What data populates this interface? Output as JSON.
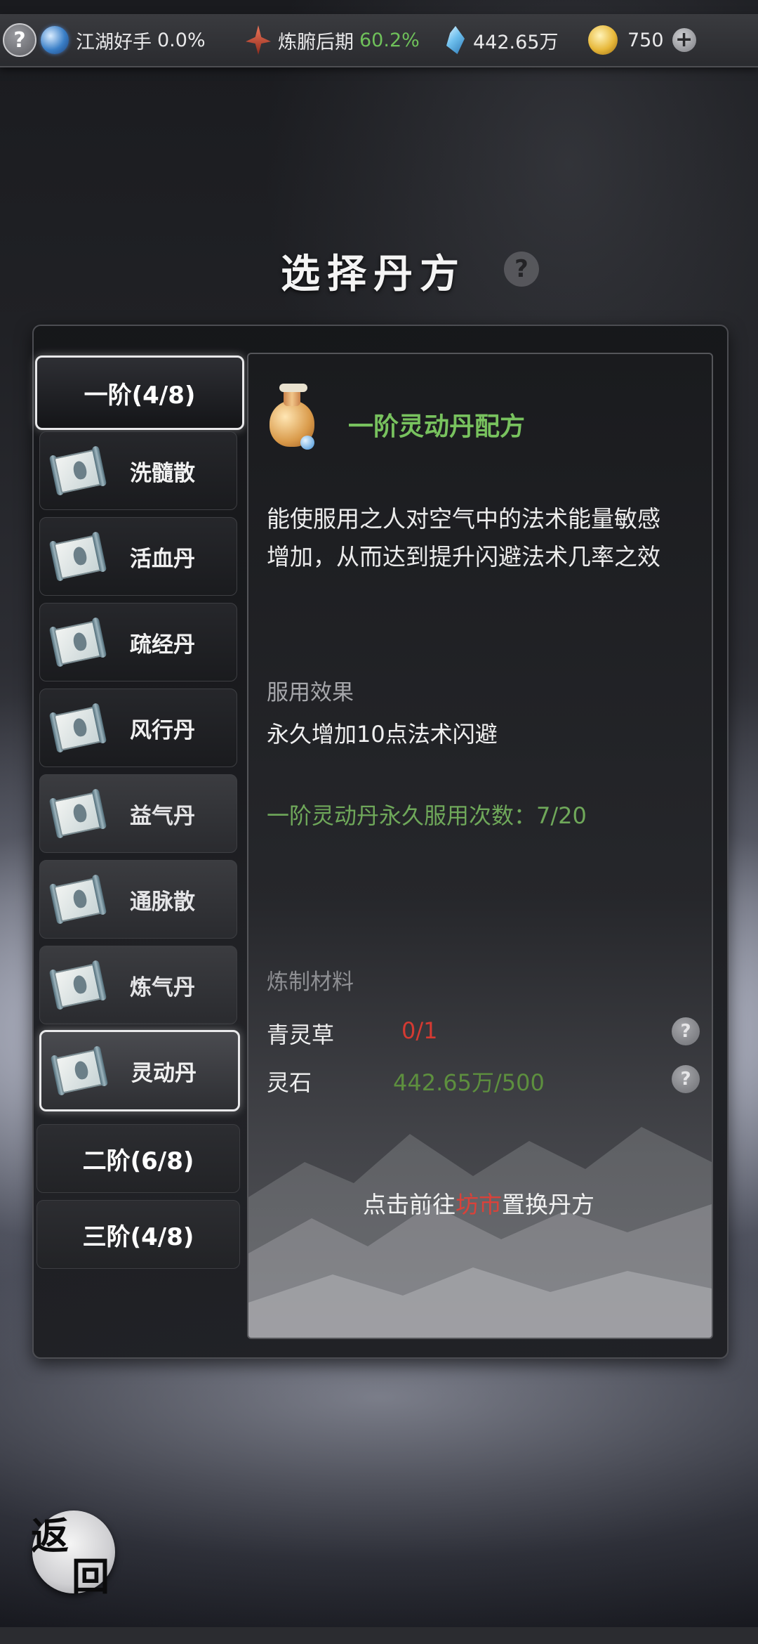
{
  "topbar": {
    "help_icon": "?",
    "sect": {
      "icon": "taichi-icon",
      "label": "江湖好手",
      "value": "0.0%"
    },
    "realm": {
      "icon": "realm-flame-icon",
      "label": "炼腑后期",
      "value": "60.2%"
    },
    "spirit_stone": {
      "icon": "spirit-stone-icon",
      "value": "442.65万"
    },
    "coins": {
      "icon": "coin-icon",
      "value": "750",
      "add": "+"
    }
  },
  "title": "选择丹方",
  "title_help": "?",
  "tiers": [
    {
      "label": "一阶(4/8)",
      "state": "expanded"
    },
    {
      "label": "二阶(6/8)",
      "state": "collapsed"
    },
    {
      "label": "三阶(4/8)",
      "state": "collapsed"
    }
  ],
  "recipes": [
    {
      "name": "洗髓散"
    },
    {
      "name": "活血丹"
    },
    {
      "name": "疏经丹"
    },
    {
      "name": "风行丹"
    },
    {
      "name": "益气丹"
    },
    {
      "name": "通脉散"
    },
    {
      "name": "炼气丹"
    },
    {
      "name": "灵动丹",
      "selected": true
    }
  ],
  "detail": {
    "recipe_title": "一阶灵动丹配方",
    "description_line1": "能使服用之人对空气中的法术能量敏感",
    "description_line2": "增加，从而达到提升闪避法术几率之效",
    "effect_label": "服用效果",
    "effect_text": "永久增加10点法术闪避",
    "usage_count": "一阶灵动丹永久服用次数：7/20",
    "materials_label": "炼制材料",
    "materials": [
      {
        "name": "青灵草",
        "qty": "0/1",
        "status_color": "#d43a32"
      },
      {
        "name": "灵石",
        "qty": "442.65万/500",
        "status_color": "#5d8f3e"
      }
    ],
    "material_help": "?",
    "goto_prefix": "点击前往",
    "goto_link": "坊市",
    "goto_suffix": "置换丹方"
  },
  "back_button": {
    "char1": "返",
    "char2": "回"
  },
  "colors": {
    "accent_green": "#78c25e",
    "warning_red": "#d43a32"
  }
}
